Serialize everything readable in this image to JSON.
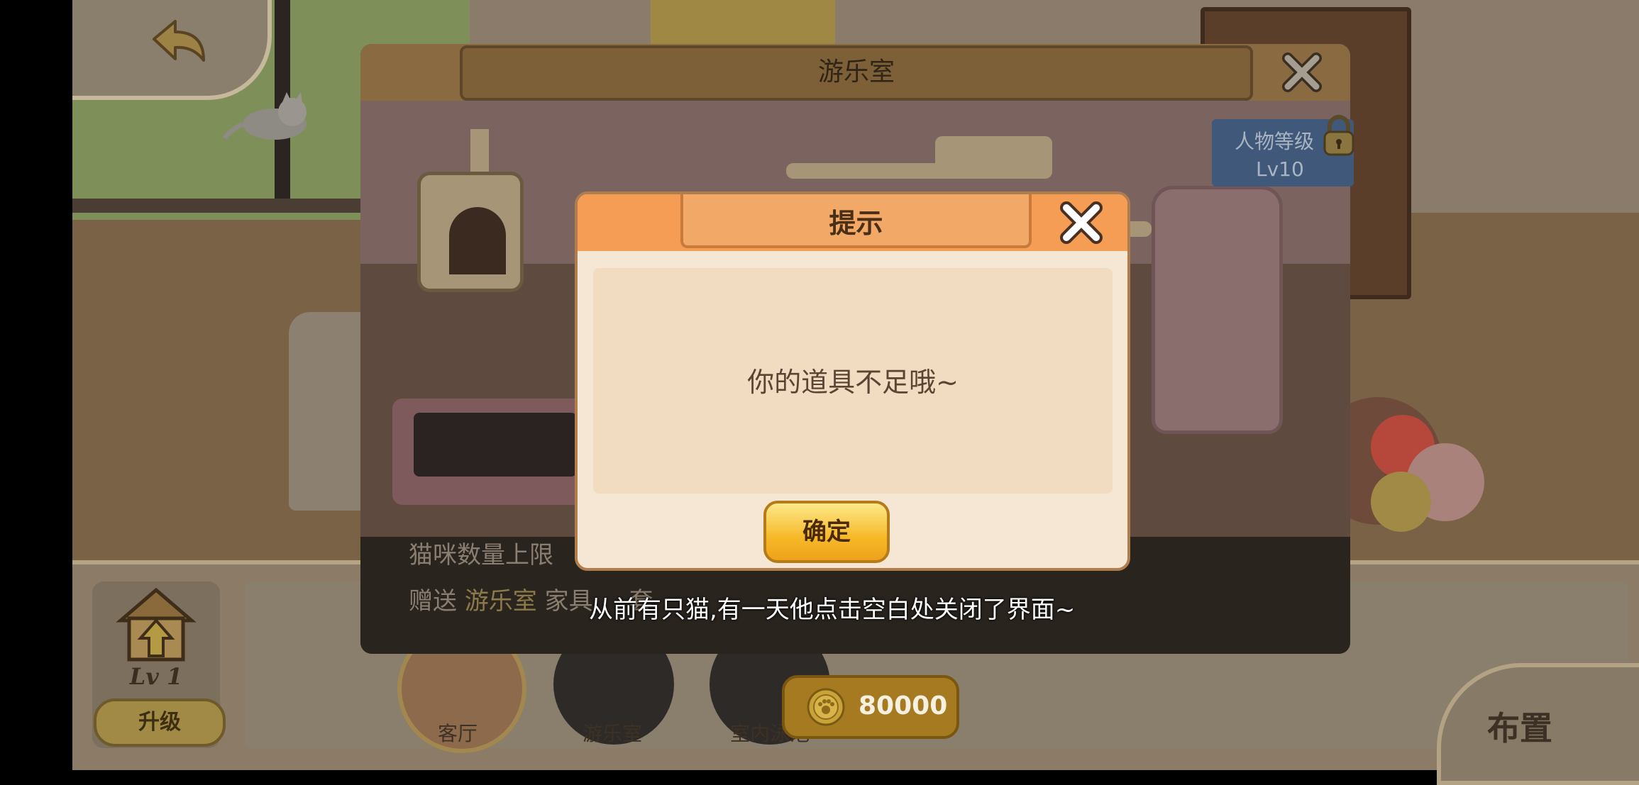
{
  "playroom": {
    "title": "游乐室",
    "level_requirement_label": "人物等级",
    "level_requirement_value": "Lv10",
    "cat_limit_label": "猫咪数量上限",
    "gift_prefix": "赠送",
    "gift_room": "游乐室",
    "gift_suffix": "家具",
    "gift_tail": "套"
  },
  "dialog": {
    "title": "提示",
    "message": "你的道具不足哦~",
    "confirm_label": "确定"
  },
  "subtitle": "从前有只猫,有一天他点击空白处关闭了界面~",
  "bottom": {
    "level": "Lv 1",
    "upgrade_label": "升级",
    "rooms": [
      "客厅",
      "游乐室",
      "室内泳池"
    ],
    "coins": "80000",
    "arrange_label": "布置"
  },
  "colors": {
    "dialog_header": "#f59d55",
    "dialog_body": "#f6e7d4",
    "confirm_button": "#f6b928",
    "level_badge": "#40587a"
  },
  "icons": [
    "back-arrow-icon",
    "close-icon",
    "lock-icon",
    "house-upgrade-icon",
    "coin-icon"
  ]
}
